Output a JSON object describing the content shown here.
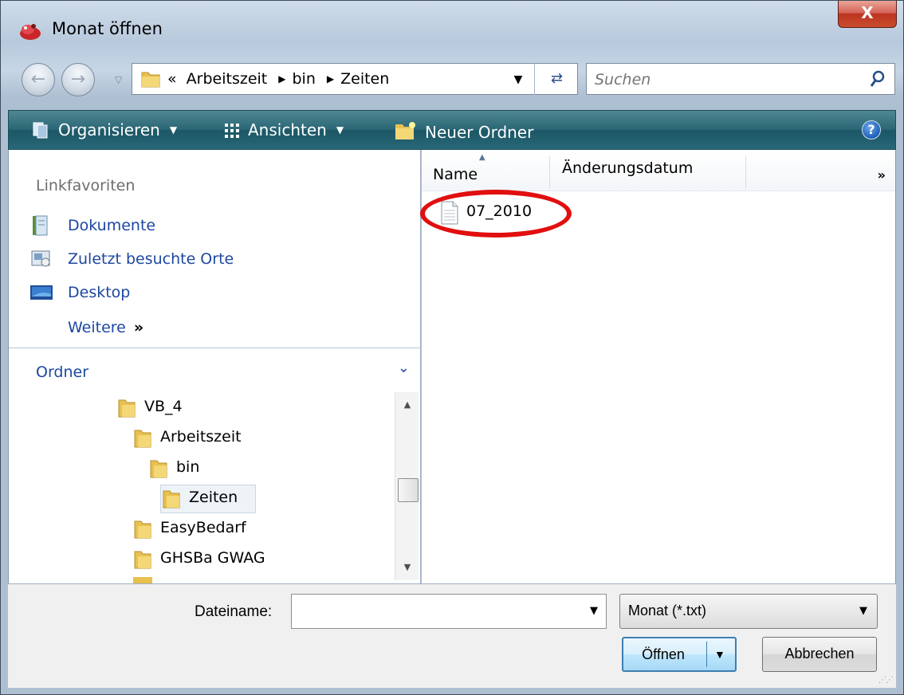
{
  "window": {
    "title": "Monat öffnen",
    "close_glyph": "X"
  },
  "address_bar": {
    "crumb_prefix": "«",
    "crumbs": [
      "Arbeitszeit",
      "bin",
      "Zeiten"
    ],
    "search_placeholder": "Suchen"
  },
  "toolbar": {
    "organize": "Organisieren",
    "views": "Ansichten",
    "new_folder": "Neuer Ordner",
    "help_glyph": "?"
  },
  "favorites": {
    "header": "Linkfavoriten",
    "items": [
      {
        "label": "Dokumente",
        "icon": "documents-icon"
      },
      {
        "label": "Zuletzt besuchte Orte",
        "icon": "recent-places-icon"
      },
      {
        "label": "Desktop",
        "icon": "desktop-icon"
      }
    ],
    "more": "Weitere",
    "more_chevron": "»"
  },
  "folders": {
    "header": "Ordner",
    "tree": [
      {
        "label": "VB_4",
        "indent": 0
      },
      {
        "label": "Arbeitszeit",
        "indent": 1
      },
      {
        "label": "bin",
        "indent": 2
      },
      {
        "label": "Zeiten",
        "indent": 3,
        "selected": true
      },
      {
        "label": "EasyBedarf",
        "indent": 1
      },
      {
        "label": "GHSBa GWAG",
        "indent": 1
      }
    ]
  },
  "file_list": {
    "columns": [
      "Name",
      "Änderungsdatum"
    ],
    "more_columns": "»",
    "files": [
      {
        "name": "07_2010",
        "icon": "text-file-icon"
      }
    ]
  },
  "bottom": {
    "filename_label": "Dateiname:",
    "filename_value": "",
    "filetype_value": "Monat (*.txt)",
    "open_button": "Öffnen",
    "cancel_button": "Abbrechen"
  },
  "colors": {
    "toolbar": "#2b6776",
    "link_blue": "#1d47a1",
    "highlight_ring": "#e10f0f",
    "close_button": "#c94d2e"
  }
}
